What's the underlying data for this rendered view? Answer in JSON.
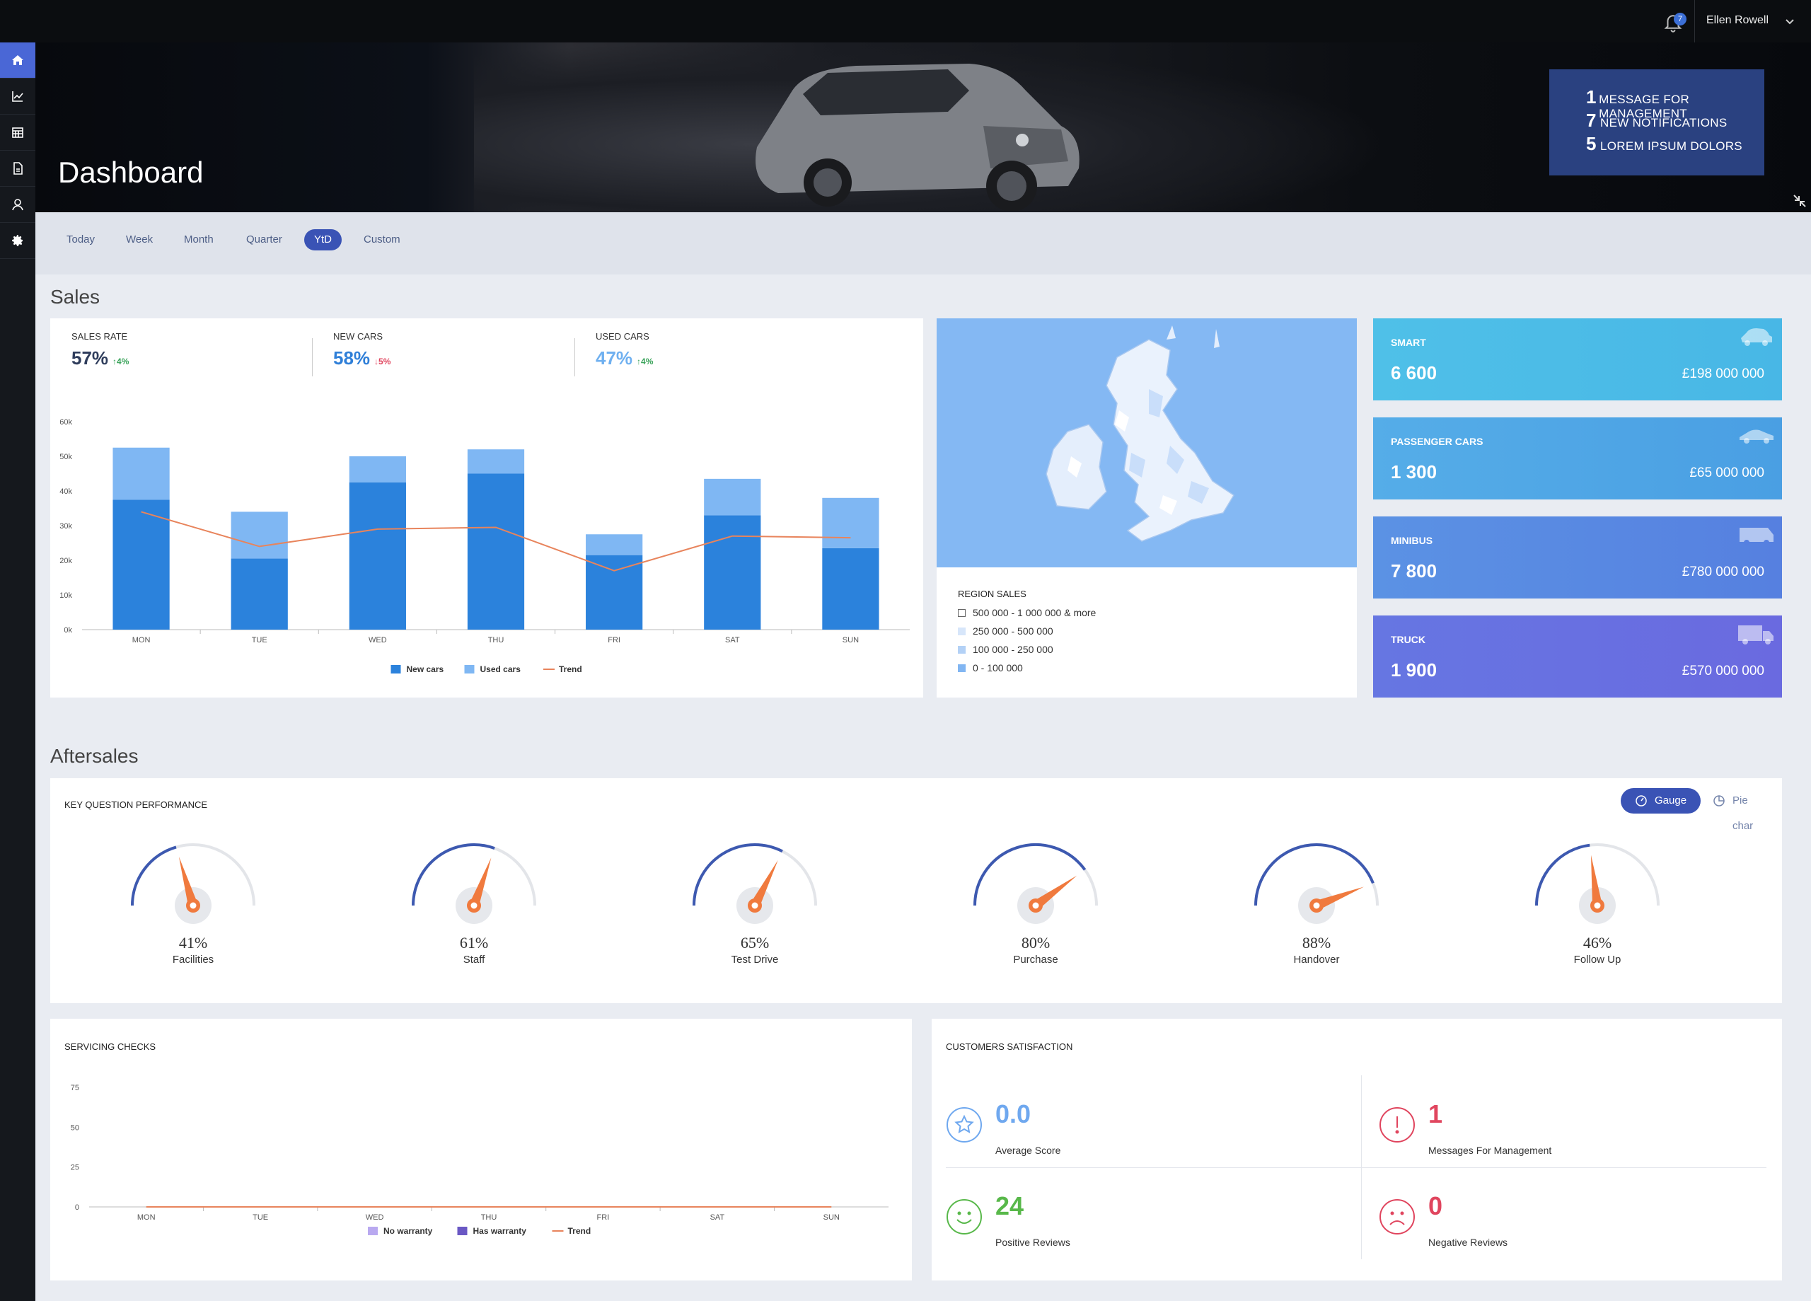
{
  "topbar": {
    "notifications_count": "7",
    "user_name": "Ellen Rowell"
  },
  "sidebar": {
    "items": [
      {
        "name": "home-icon",
        "active": true
      },
      {
        "name": "chart-icon",
        "active": false
      },
      {
        "name": "calendar-icon",
        "active": false
      },
      {
        "name": "document-icon",
        "active": false
      },
      {
        "name": "user-icon",
        "active": false
      },
      {
        "name": "gear-icon",
        "active": false
      }
    ]
  },
  "hero": {
    "title": "Dashboard",
    "messages": [
      {
        "count": "1",
        "text": "Message for management"
      },
      {
        "count": "7",
        "text": "New notifications"
      },
      {
        "count": "5",
        "text": "Lorem ipsum dolors"
      }
    ]
  },
  "tabs": [
    "Today",
    "Week",
    "Month",
    "Quarter",
    "YtD",
    "Custom"
  ],
  "active_tab": "YtD",
  "sales": {
    "section_title": "Sales",
    "kpis": [
      {
        "label": "Sales rate",
        "value": "57%",
        "change": "↑4%",
        "value_color": "#2f3d5c",
        "change_color": "#3aa35a"
      },
      {
        "label": "New cars",
        "value": "58%",
        "change": "↓5%",
        "value_color": "#2f7fd8",
        "change_color": "#e0455e"
      },
      {
        "label": "Used cars",
        "value": "47%",
        "change": "↑4%",
        "value_color": "#6fb0f0",
        "change_color": "#3aa35a"
      }
    ],
    "region": {
      "title": "Region sales",
      "legend": [
        {
          "label": "500 000 - 1 000 000 & more",
          "color": "#ffffff"
        },
        {
          "label": "250 000 - 500 000",
          "color": "#d7e6fa"
        },
        {
          "label": "100 000 - 250 000",
          "color": "#b3d1f6"
        },
        {
          "label": "0 - 100 000",
          "color": "#82b6f2"
        }
      ]
    },
    "vehicles": [
      {
        "name": "Smart",
        "count": "6 600",
        "amount": "£198 000 000",
        "color": "#4cbde6",
        "icon": "car-icon"
      },
      {
        "name": "Passenger cars",
        "count": "1 300",
        "amount": "£65 000 000",
        "color": "#4ea2e4",
        "icon": "sedan-icon"
      },
      {
        "name": "Minibus",
        "count": "7 800",
        "amount": "£780 000 000",
        "color": "#5a86e0",
        "icon": "minibus-icon"
      },
      {
        "name": "Truck",
        "count": "1 900",
        "amount": "£570 000 000",
        "color": "#6a6ee0",
        "icon": "truck-icon"
      }
    ]
  },
  "aftersales": {
    "section_title": "Aftersales",
    "kqp_title": "Key question performance",
    "toggle_gauge": "Gauge",
    "toggle_pie": "Pie char",
    "gauges": [
      {
        "label": "Facilities",
        "value": 41,
        "text": "41%"
      },
      {
        "label": "Staff",
        "value": 61,
        "text": "61%"
      },
      {
        "label": "Test Drive",
        "value": 65,
        "text": "65%"
      },
      {
        "label": "Purchase",
        "value": 80,
        "text": "80%"
      },
      {
        "label": "Handover",
        "value": 88,
        "text": "88%"
      },
      {
        "label": "Follow Up",
        "value": 46,
        "text": "46%"
      }
    ],
    "servicing_title": "Servicing checks",
    "satisfaction": {
      "title": "Customers satisfaction",
      "stats": [
        {
          "value": "0.0",
          "label": "Average Score",
          "color": "#6fa8ef",
          "icon": "star-icon"
        },
        {
          "value": "1",
          "label": "Messages For Management",
          "color": "#e0455e",
          "icon": "alert-icon"
        },
        {
          "value": "24",
          "label": "Positive Reviews",
          "color": "#58b84a",
          "icon": "smile-icon"
        },
        {
          "value": "0",
          "label": "Negative Reviews",
          "color": "#e0455e",
          "icon": "frown-icon"
        }
      ]
    }
  },
  "chart_data": [
    {
      "type": "bar",
      "stacked": true,
      "categories": [
        "MON",
        "TUE",
        "WED",
        "THU",
        "FRI",
        "SAT",
        "SUN"
      ],
      "series": [
        {
          "name": "New cars",
          "type": "bar",
          "color": "#2b82dc",
          "values": [
            37500,
            20500,
            42500,
            45000,
            21500,
            33000,
            23500
          ]
        },
        {
          "name": "Used cars",
          "type": "bar",
          "color": "#7fb7f3",
          "values": [
            15000,
            13500,
            7500,
            7000,
            6000,
            10500,
            14500
          ]
        },
        {
          "name": "Trend",
          "type": "line",
          "color": "#e8845c",
          "values": [
            34000,
            24000,
            29000,
            29500,
            17000,
            27000,
            26500
          ]
        }
      ],
      "yticks": [
        "0k",
        "10k",
        "20k",
        "30k",
        "40k",
        "50k",
        "60k"
      ],
      "ylim": [
        0,
        60000
      ],
      "legend_position": "bottom"
    },
    {
      "type": "bar",
      "stacked": true,
      "categories": [
        "MON",
        "TUE",
        "WED",
        "THU",
        "FRI",
        "SAT",
        "SUN"
      ],
      "series": [
        {
          "name": "No warranty",
          "type": "bar",
          "color": "#b9a9f0",
          "values": [
            0,
            0,
            0,
            0,
            0,
            0,
            0
          ]
        },
        {
          "name": "Has warranty",
          "type": "bar",
          "color": "#6a58c4",
          "values": [
            0,
            0,
            0,
            0,
            0,
            0,
            0
          ]
        },
        {
          "name": "Trend",
          "type": "line",
          "color": "#e8845c",
          "values": [
            0,
            0,
            0,
            0,
            0,
            0,
            0
          ]
        }
      ],
      "yticks": [
        "0",
        "25",
        "50",
        "75"
      ],
      "ylim": [
        0,
        75
      ],
      "legend_position": "bottom"
    }
  ]
}
